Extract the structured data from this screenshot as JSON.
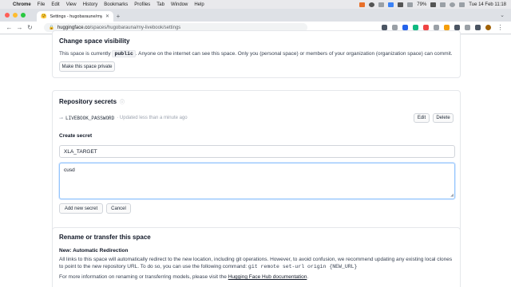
{
  "menubar": {
    "apple": "",
    "items": [
      "Chrome",
      "File",
      "Edit",
      "View",
      "History",
      "Bookmarks",
      "Profiles",
      "Tab",
      "Window",
      "Help"
    ],
    "battery": "79%",
    "clock": "Tue 14 Feb 11:18"
  },
  "browser": {
    "tab_title": "Settings - hugobaraune/my-live",
    "favicon": "🤗",
    "url_host": "huggingface.co",
    "url_path": "/spaces/hugobarauna/my-livebook/settings"
  },
  "visibility": {
    "title": "Change space visibility",
    "text_before": "This space is currently",
    "badge": "public",
    "text_after": ". Anyone on the internet can see this space. Only you (personal space) or members of your organization (organization space) can commit.",
    "button": "Make this space private"
  },
  "secrets": {
    "title": "Repository secrets",
    "info_icon": "ⓘ",
    "secret_name": "LIVEBOOK_PASSWORD",
    "secret_updated": "· Updated less than a minute ago",
    "edit_label": "Edit",
    "delete_label": "Delete",
    "create_title": "Create secret",
    "name_value": "XLA_TARGET",
    "value_value": "cusd",
    "add_button": "Add new secret",
    "cancel_button": "Cancel"
  },
  "rename": {
    "title": "Rename or transfer this space",
    "subtitle": "New: Automatic Redirection",
    "para1": "All links to this space will automatically redirect to the new location, including git operations. However, to avoid confusion, we recommend updating any existing local clones to point to the new repository URL. To do so, you can use the following command:",
    "command": "git remote set-url origin {NEW_URL}",
    "para2_before": "For more information on renaming or transferring models, please visit the",
    "para2_link": "Hugging Face Hub documentation",
    "para2_after": "."
  }
}
